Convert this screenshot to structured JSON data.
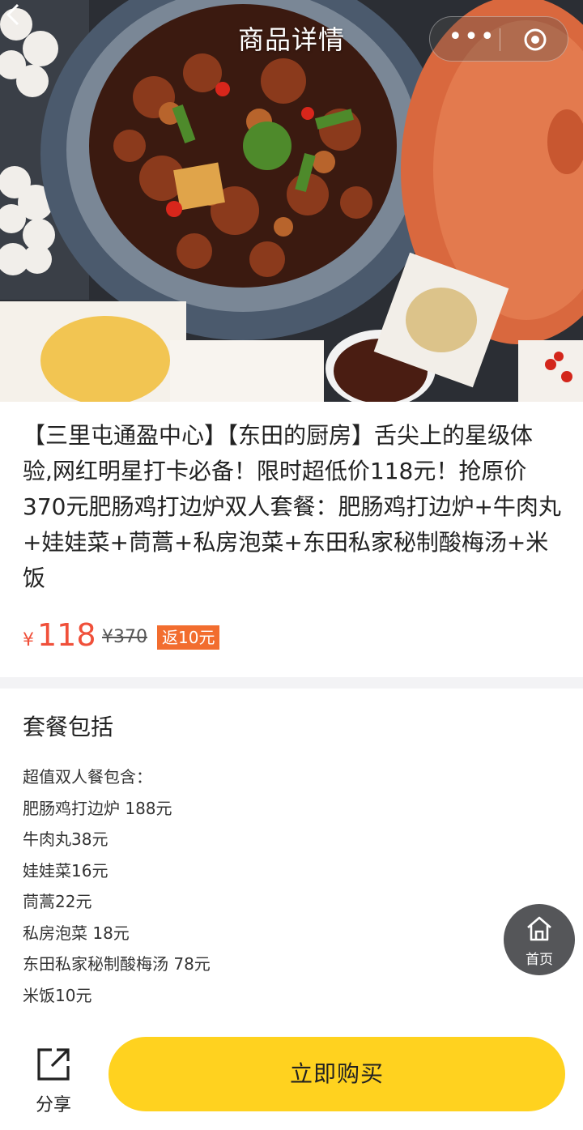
{
  "nav": {
    "title": "商品详情",
    "back_icon": "chevron-left-icon",
    "more_icon": "more-dots-icon",
    "close_icon": "target-circle-icon"
  },
  "product": {
    "title": "【三里屯通盈中心】【东田的厨房】舌尖上的星级体验,网红明星打卡必备！限时超低价118元！抢原价370元肥肠鸡打边炉双人套餐：肥肠鸡打边炉+牛肉丸+娃娃菜+茼蒿+私房泡菜+东田私家秘制酸梅汤+米饭",
    "currency": "¥",
    "price": "118",
    "original_price": "¥370",
    "rebate": "返10元"
  },
  "package": {
    "heading": "套餐包括",
    "items": [
      "超值双人餐包含：",
      "肥肠鸡打边炉 188元",
      "牛肉丸38元",
      "娃娃菜16元",
      "茼蒿22元",
      "私房泡菜 18元",
      "东田私家秘制酸梅汤 78元",
      "米饭10元"
    ]
  },
  "fab": {
    "label": "首页",
    "icon": "home-icon"
  },
  "bottom": {
    "share_label": "分享",
    "share_icon": "share-icon",
    "buy_label": "立即购买"
  },
  "colors": {
    "price": "#f0503a",
    "rebate_bg": "#f26d2f",
    "buy_bg": "#ffd21f",
    "fab_bg": "#555659"
  }
}
